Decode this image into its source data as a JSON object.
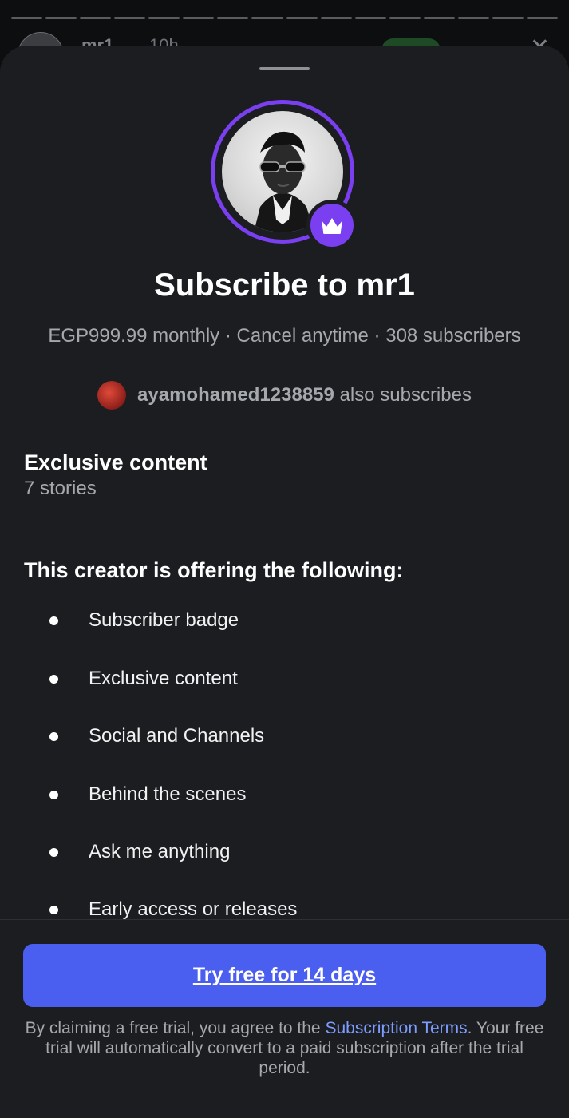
{
  "story": {
    "username": "mr1",
    "time": "10h",
    "segments": 16
  },
  "sheet": {
    "title": "Subscribe to mr1",
    "meta": "EGP999.99 monthly · Cancel anytime · 308 subscribers",
    "mutual": {
      "username": "ayamohamed1238859",
      "suffix": "also subscribes"
    },
    "exclusive": {
      "title": "Exclusive content",
      "count": "7 stories"
    },
    "offering": {
      "title": "This creator is offering the following:",
      "items": [
        "Subscriber badge",
        "Exclusive content",
        "Social and Channels",
        "Behind the scenes",
        "Ask me anything",
        "Early access or releases"
      ]
    },
    "cta_label": "Try free for 14 days",
    "disclaimer": {
      "before": "By claiming a free trial, you agree to the ",
      "link": "Subscription Terms",
      "after": ". Your free trial will automatically convert to a paid subscription after the trial period."
    }
  },
  "colors": {
    "accent_purple": "#7a3ff0",
    "cta_blue": "#4a5ef0",
    "link_blue": "#7d9cff",
    "sheet_bg": "#1b1d21"
  }
}
